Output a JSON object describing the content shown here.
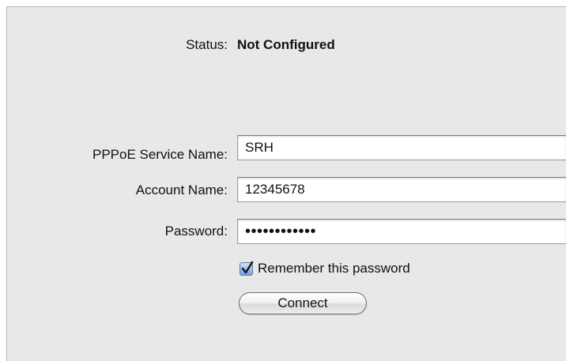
{
  "status": {
    "label": "Status:",
    "value": "Not Configured"
  },
  "form": {
    "service_name": {
      "label": "PPPoE Service Name:",
      "value": "SRH"
    },
    "account_name": {
      "label": "Account Name:",
      "value": "12345678"
    },
    "password": {
      "label": "Password:",
      "masked_value": "••••••••••••"
    },
    "remember_password": {
      "label": "Remember this password",
      "checked": true
    },
    "connect_button_label": "Connect"
  },
  "colors": {
    "panel_background": "#e8e8e8",
    "checkbox_accent": "#6fa3e6"
  }
}
